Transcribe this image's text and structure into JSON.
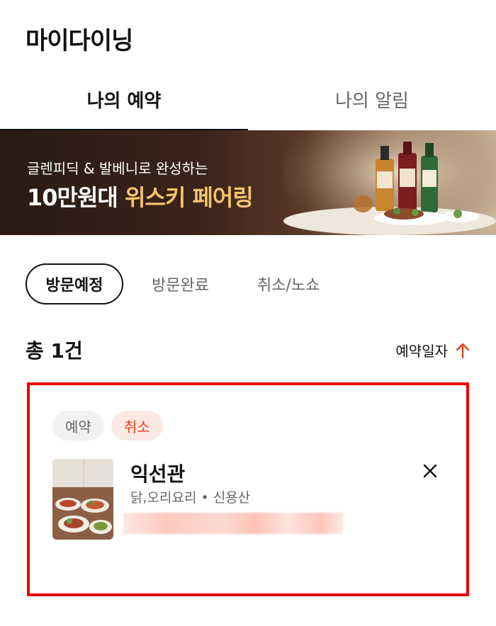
{
  "header": {
    "title": "마이다이닝"
  },
  "tabs": [
    {
      "label": "나의 예약",
      "active": true
    },
    {
      "label": "나의 알림",
      "active": false
    }
  ],
  "banner": {
    "subtitle": "글렌피딕 & 발베니로 완성하는",
    "title_prefix": "10만원대",
    "title_highlight": "위스키 페어링"
  },
  "filters": [
    {
      "label": "방문예정",
      "active": true
    },
    {
      "label": "방문완료",
      "active": false
    },
    {
      "label": "취소/노쇼",
      "active": false
    }
  ],
  "list": {
    "count_label": "총 1건",
    "sort_label": "예약일자",
    "sort_icon": "arrow-up-icon"
  },
  "reservation": {
    "type_badge": "예약",
    "cancel_badge": "취소",
    "name": "익선관",
    "meta": "닭,오리요리 • 신용산",
    "close_icon": "close-icon"
  },
  "colors": {
    "accent": "#e8431c",
    "highlight": "#f5c46b",
    "card_outline": "#ee0000"
  }
}
